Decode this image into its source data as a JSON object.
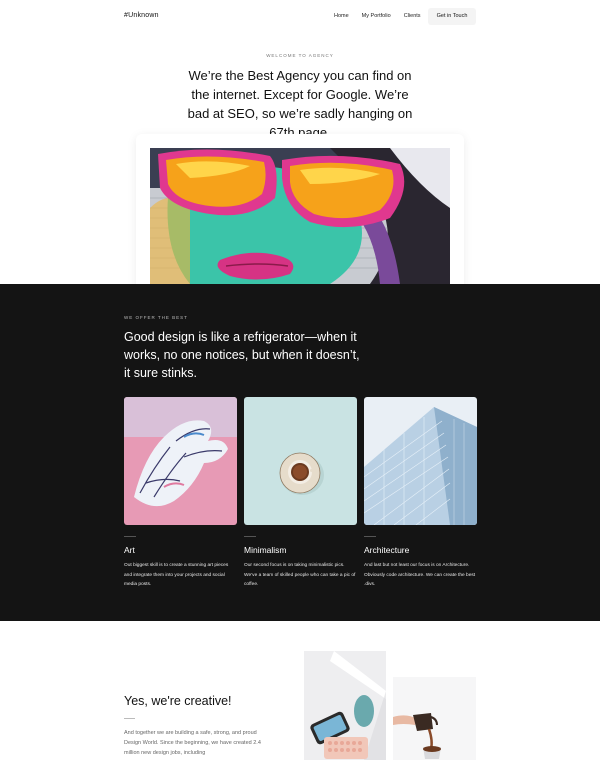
{
  "nav": {
    "brand": "#Unknown",
    "links": [
      "Home",
      "My Portfolio",
      "Clients"
    ],
    "cta": "Get in Touch"
  },
  "hero": {
    "eyebrow": "WELCOME TO AGENCY",
    "title": "We’re the Best Agency you can find on the internet. Except for Google. We’re bad at SEO, so we’re sadly hanging on 67th page."
  },
  "offer": {
    "eyebrow": "WE OFFER THE BEST",
    "title": "Good design is like a refrigerator—when it works, no one notices, but when it doesn’t, it sure stinks.",
    "cards": [
      {
        "title": "Art",
        "text": "Out biggest skill is to create a stunning art pieces and integrate them into your projects and social media posts."
      },
      {
        "title": "Minimalism",
        "text": "Our second focus is on taking minimalistic pics. We’ve a team of skilled people who can take a pic of coffee."
      },
      {
        "title": "Architecture",
        "text": "And last but not least our focus is on Architecture. Obviously code architecture. We can create the best .divs."
      }
    ]
  },
  "creative": {
    "title": "Yes, we're creative!",
    "text": "And together we are building a safe, strong, and proud Design World. Since the beginning, we have created 2.4 million new design jobs, including"
  },
  "colors": {
    "dark_bg": "#141414",
    "accent_pink": "#e0388f",
    "accent_orange": "#f6a21a"
  }
}
